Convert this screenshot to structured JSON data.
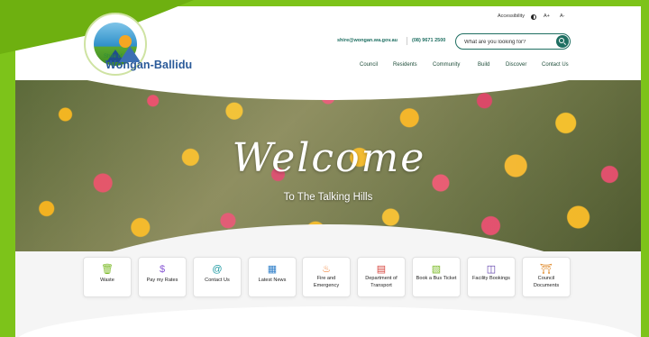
{
  "header": {
    "brand_small": "Shire of",
    "brand_name": "Wongan-Ballidu",
    "accessibility_label": "Accessibility",
    "font_increase": "A+",
    "font_decrease": "A-",
    "email": "shire@wongan.wa.gov.au",
    "phone": "(08) 9671 2500",
    "search_placeholder": "What are you looking for?"
  },
  "nav": {
    "items": [
      "Council",
      "Residents",
      "Community",
      "Build",
      "Discover",
      "Contact Us"
    ]
  },
  "hero": {
    "welcome": "Welcome",
    "tagline": "To The Talking Hills"
  },
  "quick_links": [
    {
      "label": "Waste",
      "icon": "trash-icon",
      "color": "#7dbb2a"
    },
    {
      "label": "Pay my Rates",
      "icon": "dollar-icon",
      "color": "#8a5ad6"
    },
    {
      "label": "Contact Us",
      "icon": "at-icon",
      "color": "#1f9aa3"
    },
    {
      "label": "Latest News",
      "icon": "news-icon",
      "color": "#2f7fc9"
    },
    {
      "label": "Fire and Emergency",
      "icon": "fire-icon",
      "color": "#f07a2a"
    },
    {
      "label": "Department of Transport",
      "icon": "transport-icon",
      "color": "#d6433c"
    },
    {
      "label": "Book a Bus Ticket",
      "icon": "bus-icon",
      "color": "#7dbb2a"
    },
    {
      "label": "Facility Bookings",
      "icon": "book-icon",
      "color": "#5a3aa8"
    },
    {
      "label": "Council Documents",
      "icon": "building-icon",
      "color": "#e08a2a"
    }
  ],
  "colors": {
    "brand_green": "#7dc31a",
    "accent_teal": "#1f6f62",
    "brand_blue": "#2a5a99"
  }
}
